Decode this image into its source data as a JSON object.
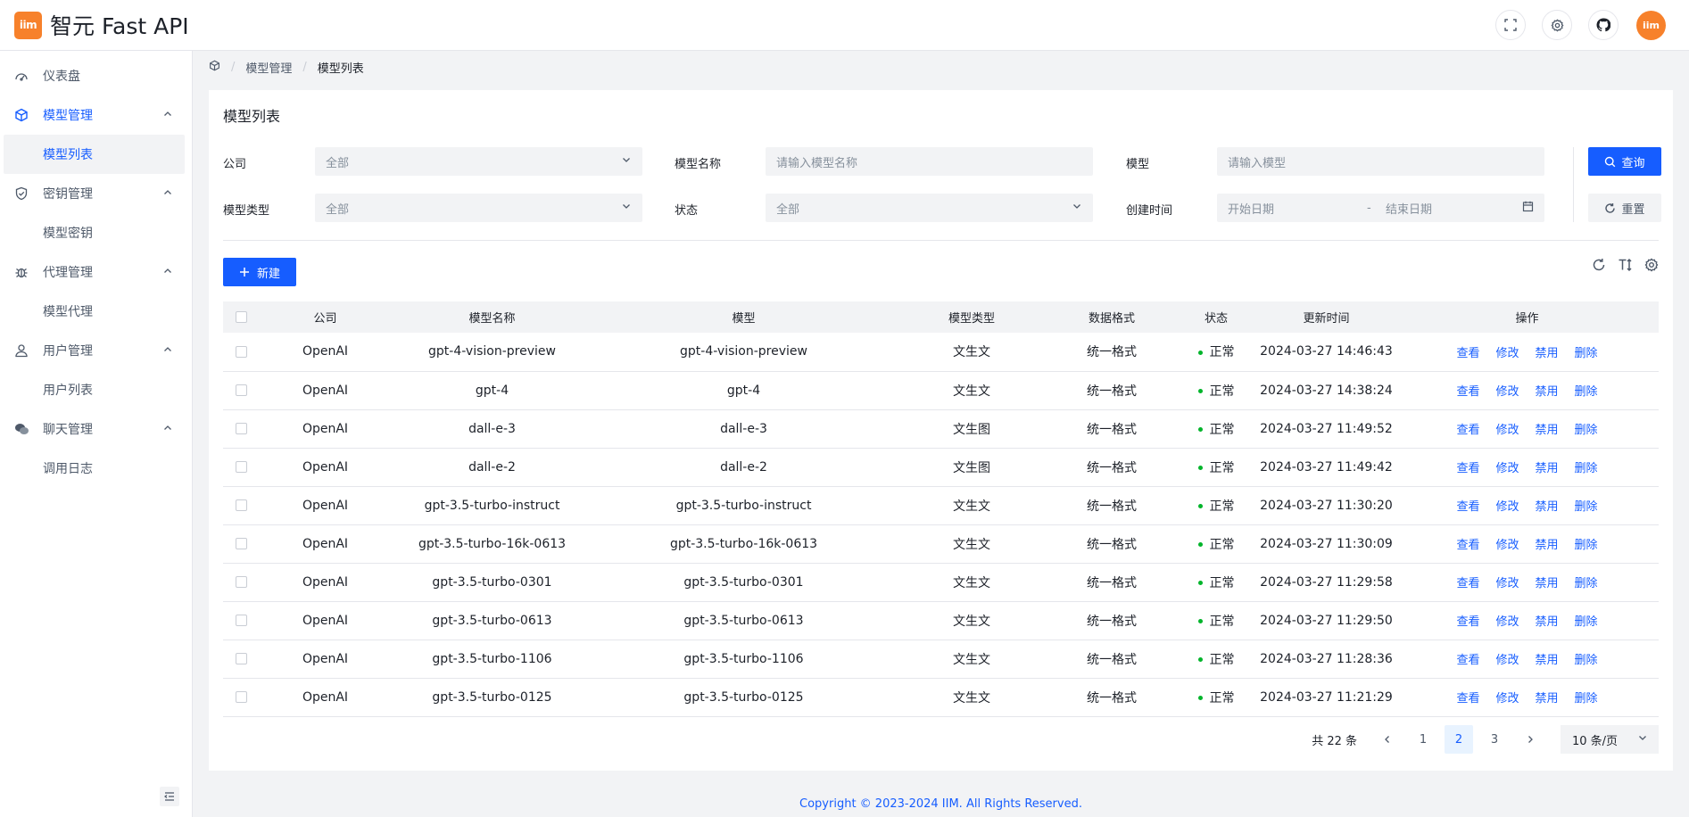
{
  "app": {
    "logo_text": "iim",
    "title": "智元 Fast API",
    "avatar_text": "iim"
  },
  "header": {
    "icons": [
      "fullscreen-icon",
      "settings-icon",
      "github-icon"
    ]
  },
  "sidebar": {
    "items": [
      {
        "label": "仪表盘",
        "icon": "dashboard-icon"
      },
      {
        "label": "模型管理",
        "icon": "cube-icon",
        "children": [
          "模型列表"
        ]
      },
      {
        "label": "密钥管理",
        "icon": "shield-icon",
        "children": [
          "模型密钥"
        ]
      },
      {
        "label": "代理管理",
        "icon": "bug-icon",
        "children": [
          "模型代理"
        ]
      },
      {
        "label": "用户管理",
        "icon": "user-icon",
        "children": [
          "用户列表"
        ]
      },
      {
        "label": "聊天管理",
        "icon": "chat-icon",
        "children": [
          "调用日志"
        ]
      }
    ]
  },
  "breadcrumb": {
    "level1": "模型管理",
    "level2": "模型列表"
  },
  "page": {
    "title": "模型列表"
  },
  "filters": {
    "company": {
      "label": "公司",
      "value": "全部"
    },
    "model_name": {
      "label": "模型名称",
      "placeholder": "请输入模型名称"
    },
    "model": {
      "label": "模型",
      "placeholder": "请输入模型"
    },
    "model_type": {
      "label": "模型类型",
      "value": "全部"
    },
    "status": {
      "label": "状态",
      "value": "全部"
    },
    "created": {
      "label": "创建时间",
      "start": "开始日期",
      "sep": "-",
      "end": "结束日期"
    },
    "query": "查询",
    "reset": "重置"
  },
  "toolbar": {
    "new": "新建"
  },
  "table": {
    "columns": [
      "公司",
      "模型名称",
      "模型",
      "模型类型",
      "数据格式",
      "状态",
      "更新时间",
      "操作"
    ],
    "actions": [
      "查看",
      "修改",
      "禁用",
      "删除"
    ],
    "rows": [
      {
        "company": "OpenAI",
        "name": "gpt-4-vision-preview",
        "model": "gpt-4-vision-preview",
        "type": "文生文",
        "format": "统一格式",
        "status": "正常",
        "updated": "2024-03-27 14:46:43"
      },
      {
        "company": "OpenAI",
        "name": "gpt-4",
        "model": "gpt-4",
        "type": "文生文",
        "format": "统一格式",
        "status": "正常",
        "updated": "2024-03-27 14:38:24"
      },
      {
        "company": "OpenAI",
        "name": "dall-e-3",
        "model": "dall-e-3",
        "type": "文生图",
        "format": "统一格式",
        "status": "正常",
        "updated": "2024-03-27 11:49:52"
      },
      {
        "company": "OpenAI",
        "name": "dall-e-2",
        "model": "dall-e-2",
        "type": "文生图",
        "format": "统一格式",
        "status": "正常",
        "updated": "2024-03-27 11:49:42"
      },
      {
        "company": "OpenAI",
        "name": "gpt-3.5-turbo-instruct",
        "model": "gpt-3.5-turbo-instruct",
        "type": "文生文",
        "format": "统一格式",
        "status": "正常",
        "updated": "2024-03-27 11:30:20"
      },
      {
        "company": "OpenAI",
        "name": "gpt-3.5-turbo-16k-0613",
        "model": "gpt-3.5-turbo-16k-0613",
        "type": "文生文",
        "format": "统一格式",
        "status": "正常",
        "updated": "2024-03-27 11:30:09"
      },
      {
        "company": "OpenAI",
        "name": "gpt-3.5-turbo-0301",
        "model": "gpt-3.5-turbo-0301",
        "type": "文生文",
        "format": "统一格式",
        "status": "正常",
        "updated": "2024-03-27 11:29:58"
      },
      {
        "company": "OpenAI",
        "name": "gpt-3.5-turbo-0613",
        "model": "gpt-3.5-turbo-0613",
        "type": "文生文",
        "format": "统一格式",
        "status": "正常",
        "updated": "2024-03-27 11:29:50"
      },
      {
        "company": "OpenAI",
        "name": "gpt-3.5-turbo-1106",
        "model": "gpt-3.5-turbo-1106",
        "type": "文生文",
        "format": "统一格式",
        "status": "正常",
        "updated": "2024-03-27 11:28:36"
      },
      {
        "company": "OpenAI",
        "name": "gpt-3.5-turbo-0125",
        "model": "gpt-3.5-turbo-0125",
        "type": "文生文",
        "format": "统一格式",
        "status": "正常",
        "updated": "2024-03-27 11:21:29"
      }
    ]
  },
  "pagination": {
    "total": "共 22 条",
    "pages": [
      "1",
      "2",
      "3"
    ],
    "current": "2",
    "page_size": "10 条/页"
  },
  "footer": {
    "copyright": "Copyright © 2023-2024 IIM. All Rights Reserved."
  },
  "colors": {
    "primary": "#165dff",
    "brand": "#f7812b",
    "success": "#00b42a"
  }
}
